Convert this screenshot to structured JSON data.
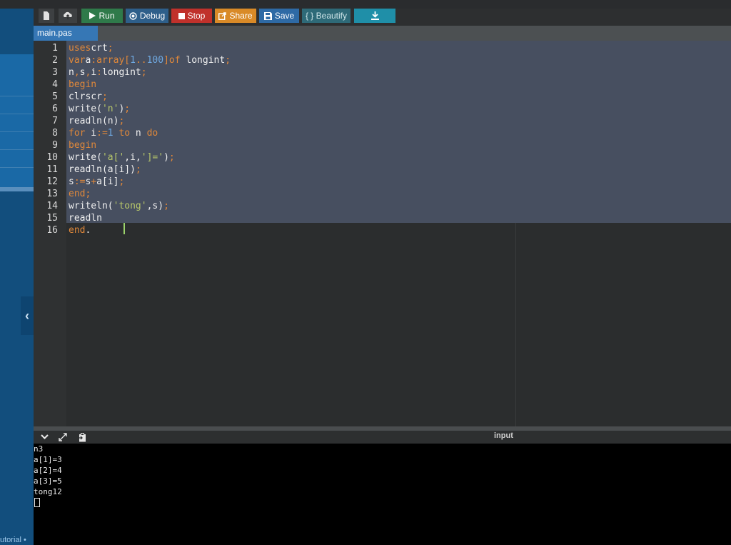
{
  "toolbar": {
    "run_label": "Run",
    "debug_label": "Debug",
    "stop_label": "Stop",
    "share_label": "Share",
    "save_label": "Save",
    "beautify_label": "{ } Beautify",
    "colors": {
      "run": "#2f7a4a",
      "debug": "#2e5f8a",
      "stop": "#c0312b",
      "share": "#d98a27",
      "save": "#2e6aa5",
      "beautify": "#2e6a78",
      "download": "#1f8fa8"
    }
  },
  "tabs": {
    "active_file": "main.pas"
  },
  "editor": {
    "lines": [
      {
        "n": "1",
        "t": [
          [
            "kw",
            "uses"
          ],
          [
            "",
            "crt"
          ],
          [
            "op",
            ";"
          ]
        ]
      },
      {
        "n": "2",
        "t": [
          [
            "kw",
            "var"
          ],
          [
            "",
            "a"
          ],
          [
            "op",
            ":"
          ],
          [
            "kw",
            "array"
          ],
          [
            "op",
            "["
          ],
          [
            "num",
            "1"
          ],
          [
            "op",
            ".."
          ],
          [
            "num",
            "100"
          ],
          [
            "op",
            "]"
          ],
          [
            "kw",
            "of"
          ],
          [
            "",
            " longint"
          ],
          [
            "op",
            ";"
          ]
        ]
      },
      {
        "n": "3",
        "t": [
          [
            "",
            "n"
          ],
          [
            "op",
            ","
          ],
          [
            "",
            "s"
          ],
          [
            "op",
            ","
          ],
          [
            "",
            "i"
          ],
          [
            "op",
            ":"
          ],
          [
            "",
            "longint"
          ],
          [
            "op",
            ";"
          ]
        ]
      },
      {
        "n": "4",
        "t": [
          [
            "kw",
            "begin"
          ]
        ]
      },
      {
        "n": "5",
        "t": [
          [
            "",
            "clrscr"
          ],
          [
            "op",
            ";"
          ]
        ]
      },
      {
        "n": "6",
        "t": [
          [
            "",
            "write("
          ],
          [
            "str",
            "'n'"
          ],
          [
            "",
            ")"
          ],
          [
            "op",
            ";"
          ]
        ]
      },
      {
        "n": "7",
        "t": [
          [
            "",
            "readln(n)"
          ],
          [
            "op",
            ";"
          ]
        ]
      },
      {
        "n": "8",
        "t": [
          [
            "kw",
            "for"
          ],
          [
            "",
            " i"
          ],
          [
            "op",
            ":="
          ],
          [
            "num",
            "1"
          ],
          [
            "kw",
            " to"
          ],
          [
            "",
            " n"
          ],
          [
            "kw",
            " do"
          ]
        ]
      },
      {
        "n": "9",
        "t": [
          [
            "kw",
            "begin"
          ]
        ]
      },
      {
        "n": "10",
        "t": [
          [
            "",
            "write("
          ],
          [
            "str",
            "'a['"
          ],
          [
            "",
            ",i,"
          ],
          [
            "str",
            "']='"
          ],
          [
            "",
            ")"
          ],
          [
            "op",
            ";"
          ]
        ]
      },
      {
        "n": "11",
        "t": [
          [
            "",
            "readln(a[i])"
          ],
          [
            "op",
            ";"
          ]
        ]
      },
      {
        "n": "12",
        "t": [
          [
            "",
            "s"
          ],
          [
            "op",
            ":="
          ],
          [
            "",
            "s"
          ],
          [
            "op",
            "+"
          ],
          [
            "",
            "a[i]"
          ],
          [
            "op",
            ";"
          ]
        ]
      },
      {
        "n": "13",
        "t": [
          [
            "kw",
            "end"
          ],
          [
            "op",
            ";"
          ]
        ]
      },
      {
        "n": "14",
        "t": [
          [
            "",
            "writeln("
          ],
          [
            "str",
            "'tong'"
          ],
          [
            "",
            ",s)"
          ],
          [
            "op",
            ";"
          ]
        ]
      },
      {
        "n": "15",
        "t": [
          [
            "",
            "readln"
          ]
        ]
      },
      {
        "n": "16",
        "t": [
          [
            "kw",
            "end"
          ],
          [
            "",
            "."
          ]
        ]
      }
    ]
  },
  "output": {
    "input_label": "input",
    "console_lines": [
      "n3",
      "a[1]=3",
      "a[2]=4",
      "a[3]=5",
      "tong12"
    ]
  },
  "sidebar": {
    "tutorial_label": "utorial •",
    "colors": {
      "bg": "#124e7d",
      "highlight": "#1a6aa5"
    }
  },
  "icons": [
    "new-file-icon",
    "upload-icon",
    "play-icon",
    "debug-icon",
    "stop-icon",
    "share-icon",
    "save-icon",
    "download-icon",
    "chevron-down-icon",
    "expand-icon",
    "clipboard-icon",
    "chevron-left-icon"
  ]
}
